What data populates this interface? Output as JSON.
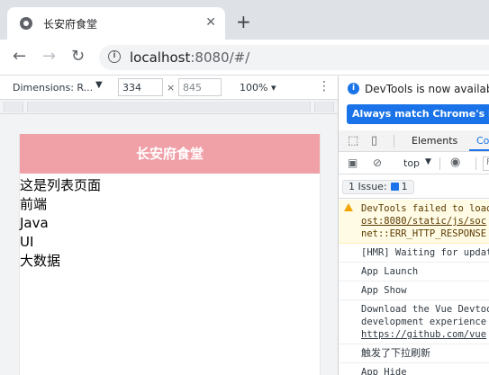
{
  "browser": {
    "tab_title": "长安府食堂",
    "tab_close": "✕",
    "new_tab": "+",
    "url_host": "localhost",
    "url_path": ":8080/#/",
    "back": "←",
    "forward": "→",
    "reload": "↻"
  },
  "device_toolbar": {
    "dimensions": "Dimensions: R...",
    "width": "334",
    "times": "×",
    "height": "845",
    "zoom": "100% ▾",
    "more": "⋮"
  },
  "app": {
    "title": "长安府食堂",
    "lines": [
      "这是列表页面",
      "前端",
      "Java",
      "UI",
      "大数据"
    ]
  },
  "devtools": {
    "info_text": "DevTools is now available in",
    "match_button": "Always match Chrome's language",
    "tabs": {
      "elements": "Elements",
      "console": "Co"
    },
    "console_toolbar": {
      "context": "top",
      "filter": "F"
    },
    "issues": {
      "label": "1 Issue:",
      "count": "1"
    },
    "messages": [
      {
        "type": "warning",
        "lines": [
          "DevTools failed to load",
          "ost:8080/static/js/soc",
          "net::ERR_HTTP_RESPONSE"
        ]
      },
      {
        "type": "log",
        "lines": [
          "[HMR] Waiting for update"
        ]
      },
      {
        "type": "log",
        "lines": [
          "App Launch"
        ]
      },
      {
        "type": "log",
        "lines": [
          "App Show"
        ]
      },
      {
        "type": "log",
        "lines": [
          "Download the Vue Devtoo",
          "development experience",
          "https://github.com/vue"
        ]
      },
      {
        "type": "log-cjk",
        "lines": [
          "触发了下拉刷新"
        ]
      },
      {
        "type": "log",
        "lines": [
          "App Hide"
        ]
      }
    ]
  }
}
